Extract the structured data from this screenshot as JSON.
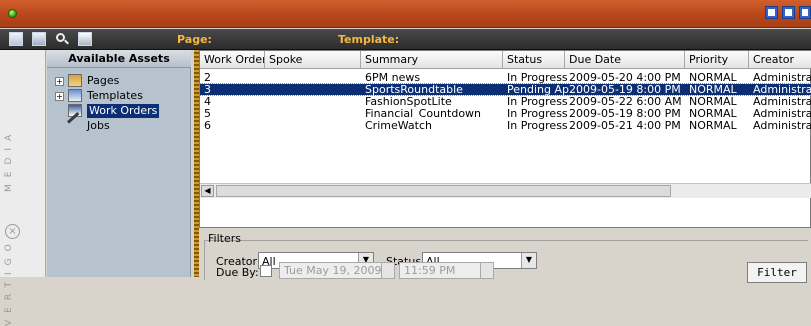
{
  "toolbar": {
    "page_label": "Page:",
    "template_label": "Template:"
  },
  "sidebar": {
    "vertical_text_top": "MEDIA",
    "vertical_text_bottom": "VERTIGO"
  },
  "assets": {
    "header": "Available Assets",
    "items": [
      {
        "label": "Pages",
        "icon": "pages-icon",
        "expand": "+"
      },
      {
        "label": "Templates",
        "icon": "templates-icon",
        "expand": "+"
      },
      {
        "label": "Work Orders",
        "icon": "work-orders-icon",
        "selected": true
      },
      {
        "label": "Jobs",
        "icon": "pen-icon"
      }
    ]
  },
  "grid": {
    "columns": [
      "Work Order",
      "Spoke",
      "Summary",
      "Status",
      "Due Date",
      "Priority",
      "Creator"
    ],
    "rows": [
      {
        "work_order": "2",
        "spoke": "",
        "summary": "6PM news",
        "status": "In Progress",
        "due_date": "2009-05-20 4:00 PM",
        "priority": "NORMAL",
        "creator": "Administrator"
      },
      {
        "work_order": "3",
        "spoke": "",
        "summary": "SportsRoundtable",
        "status": "Pending Ap...",
        "due_date": "2009-05-19 8:00 PM",
        "priority": "NORMAL",
        "creator": "Administrator"
      },
      {
        "work_order": "4",
        "spoke": "",
        "summary": "FashionSpotLite",
        "status": "In Progress",
        "due_date": "2009-05-22 6:00 AM",
        "priority": "NORMAL",
        "creator": "Administrator"
      },
      {
        "work_order": "5",
        "spoke": "",
        "summary": "Financial_Countdown",
        "status": "In Progress",
        "due_date": "2009-05-19 8:00 PM",
        "priority": "NORMAL",
        "creator": "Administrator"
      },
      {
        "work_order": "6",
        "spoke": "",
        "summary": "CrimeWatch",
        "status": "In Progress",
        "due_date": "2009-05-21 4:00 PM",
        "priority": "NORMAL",
        "creator": "Administrator"
      }
    ]
  },
  "filters": {
    "title": "Filters",
    "creator_label": "Creator:",
    "creator_value": "All",
    "status_label": "Status:",
    "status_value": "All",
    "due_by_label": "Due By:",
    "date_value": "Tue May 19, 2009",
    "time_value": "11:59 PM",
    "filter_button": "Filter"
  }
}
